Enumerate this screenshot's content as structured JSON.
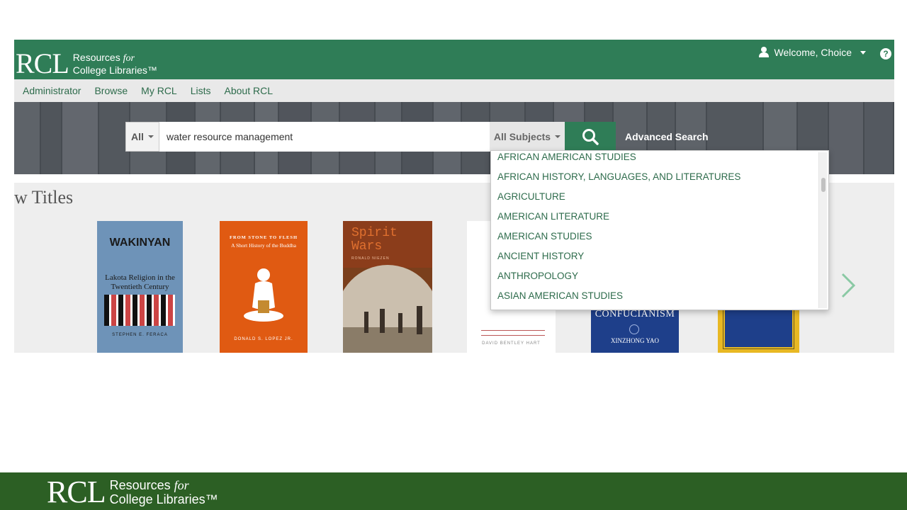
{
  "brand": {
    "logo_big": "RCL",
    "logo_line1_prefix": "Resources ",
    "logo_line1_italic": "for",
    "logo_line2": "College Libraries™"
  },
  "header": {
    "welcome": "Welcome, Choice",
    "help_glyph": "?"
  },
  "nav": [
    "Administrator",
    "Browse",
    "My RCL",
    "Lists",
    "About RCL"
  ],
  "search": {
    "scope": "All",
    "value": "water resource management",
    "subjects_label": "All Subjects",
    "advanced_label": "Advanced Search"
  },
  "subjects_dropdown": [
    "AFRICAN AMERICAN STUDIES",
    "AFRICAN HISTORY, LANGUAGES, AND LITERATURES",
    "AGRICULTURE",
    "AMERICAN LITERATURE",
    "AMERICAN STUDIES",
    "ANCIENT HISTORY",
    "ANTHROPOLOGY",
    "ASIAN AMERICAN STUDIES"
  ],
  "titles": {
    "heading": "w Titles",
    "books": [
      {
        "title": "WAKINYAN",
        "subtitle": "Lakota Religion in the Twentieth Century",
        "author": "STEPHEN E. FERACA"
      },
      {
        "title": "FROM STONE TO FLESH",
        "subtitle": "A Short History of the Buddha",
        "author": "DONALD S. LOPEZ JR."
      },
      {
        "title": "Spirit Wars",
        "author": "RONALD NIEZEN"
      },
      {
        "author": "DAVID BENTLEY HART"
      },
      {
        "title": "CONFUCIANISM",
        "author": "XINZHONG YAO"
      },
      {}
    ]
  },
  "colors": {
    "primary_green": "#2f7d57",
    "footer_green": "#2c5f24",
    "link_green": "#2d6b4b"
  },
  "icons": {
    "user": "user-icon",
    "help": "help-icon",
    "search": "search-icon",
    "next": "chevron-right-icon"
  }
}
